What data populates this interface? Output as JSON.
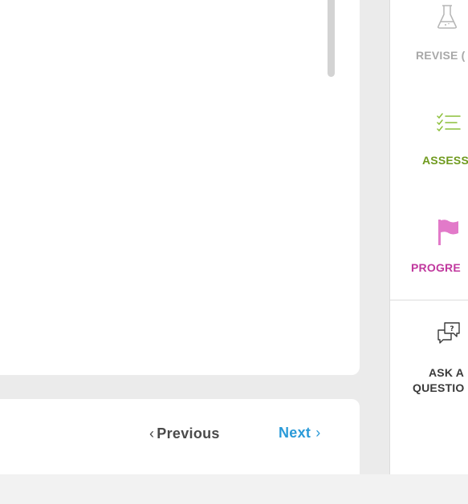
{
  "navigation": {
    "previous_label": "Previous",
    "previous_chevron": "‹",
    "next_label": "Next",
    "next_chevron": "›",
    "next_color": "#2a9ad8"
  },
  "sidebar": {
    "items": [
      {
        "id": "revise",
        "label": "REVISE (",
        "icon": "flask-icon",
        "color": "#a8a8a8"
      },
      {
        "id": "assess",
        "label": "ASSESS",
        "icon": "checklist-icon",
        "color": "#6f9a1e"
      },
      {
        "id": "progress",
        "label": "PROGRE",
        "icon": "flag-icon",
        "color": "#c0389e"
      },
      {
        "id": "ask",
        "label_line1": "ASK A",
        "label_line2": "QUESTIO",
        "icon": "question-chat-icon",
        "color": "#3a3a3a"
      }
    ]
  }
}
